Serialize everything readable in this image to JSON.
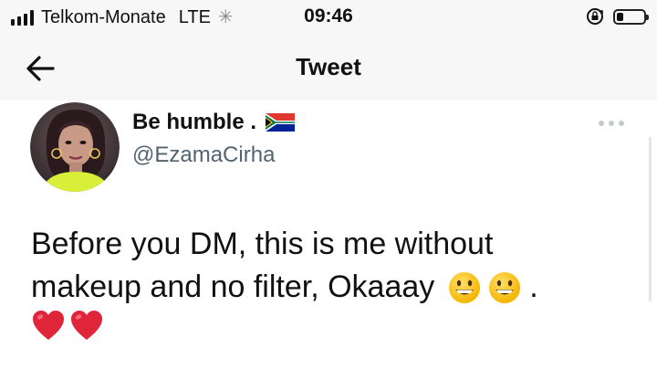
{
  "status_bar": {
    "carrier": "Telkom-Monate",
    "network": "LTE",
    "time": "09:46",
    "signal_bars": 4,
    "battery_level": 0.25
  },
  "nav": {
    "title": "Tweet",
    "back_icon": "arrow-left-icon"
  },
  "tweet": {
    "author_name": "Be humble .",
    "author_flag": "south-africa-flag",
    "handle": "@EzamaCirha",
    "text_line1": "Before you DM, this is me without",
    "text_line2": "makeup and no filter, Okaaay",
    "text_line2_suffix": ".",
    "emojis": [
      "grinning-face",
      "grinning-face",
      "red-heart",
      "red-heart"
    ]
  },
  "colors": {
    "handle": "#536471",
    "bar_background": "#f7f7f7",
    "heart": "#e0243a",
    "emoji_face": "#ffcc33"
  }
}
